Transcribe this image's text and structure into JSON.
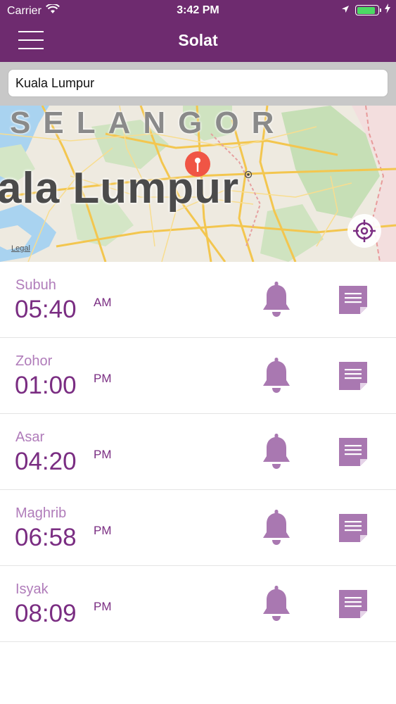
{
  "status_bar": {
    "carrier": "Carrier",
    "time": "3:42 PM",
    "battery_level": 0.9,
    "icons": [
      "wifi-icon",
      "location-arrow-icon",
      "battery-icon",
      "charging-icon"
    ]
  },
  "nav": {
    "title": "Solat",
    "menu_icon": "hamburger-menu-icon"
  },
  "search": {
    "value": "Kuala Lumpur"
  },
  "map": {
    "region_label": "SELANGOR",
    "city_label": "ala Lumpur",
    "legal": "Legal",
    "locate_icon": "crosshair-icon"
  },
  "colors": {
    "header": "#6e2b6f",
    "accent": "#7a2d82",
    "accent_light": "#b07cba",
    "icon": "#a978b1",
    "pin": "#f05545"
  },
  "prayers": [
    {
      "name": "Subuh",
      "time": "05:40",
      "period": "AM"
    },
    {
      "name": "Zohor",
      "time": "01:00",
      "period": "PM"
    },
    {
      "name": "Asar",
      "time": "04:20",
      "period": "PM"
    },
    {
      "name": "Maghrib",
      "time": "06:58",
      "period": "PM"
    },
    {
      "name": "Isyak",
      "time": "08:09",
      "period": "PM"
    }
  ]
}
